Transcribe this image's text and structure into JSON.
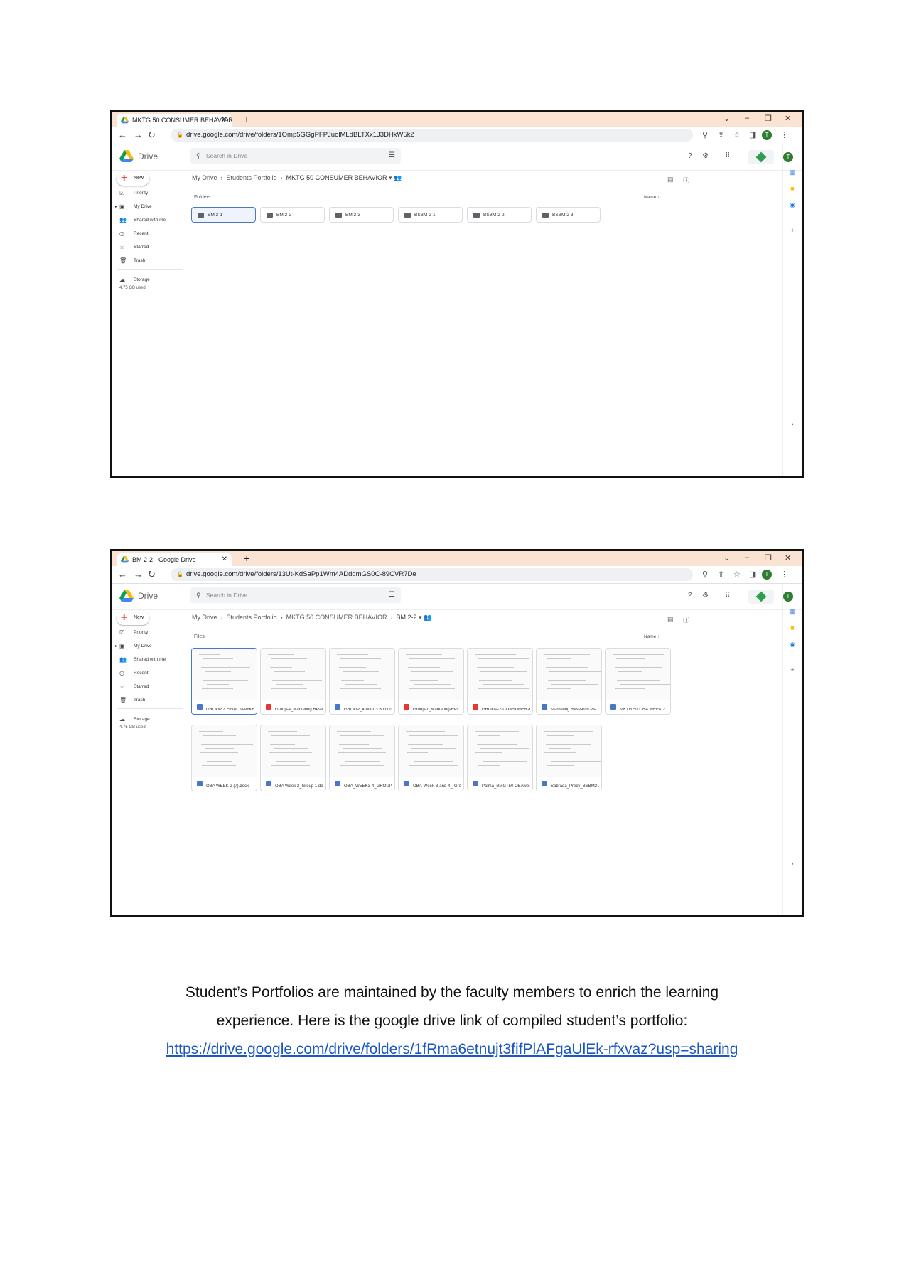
{
  "screenshot1": {
    "tab_title": "MKTG 50 CONSUMER BEHAVIOR",
    "url": "drive.google.com/drive/folders/1Omp5GGgPFPJuolMLdBLTXx1J3DHkW5kZ",
    "app_name": "Drive",
    "search_placeholder": "Search in Drive",
    "avatar_letter": "T",
    "new_label": "New",
    "nav": [
      "Priority",
      "My Drive",
      "Shared with me",
      "Recent",
      "Starred",
      "Trash",
      "Storage"
    ],
    "storage_used": "4.75 GB used",
    "breadcrumb": [
      "My Drive",
      "Students Portfolio",
      "MKTG 50 CONSUMER BEHAVIOR"
    ],
    "section_label": "Folders",
    "sort_label": "Name",
    "folders": [
      "BM 2-1",
      "BM 2-2",
      "BM 2-3",
      "BSBM 2-1",
      "BSBM 2-2",
      "BSBM 2-3"
    ]
  },
  "screenshot2": {
    "tab_title": "BM 2-2 - Google Drive",
    "url": "drive.google.com/drive/folders/13Ut-KdSaPp1Wm4ADddmGS0C-89CVR7De",
    "app_name": "Drive",
    "search_placeholder": "Search in Drive",
    "avatar_letter": "T",
    "new_label": "New",
    "nav": [
      "Priority",
      "My Drive",
      "Shared with me",
      "Recent",
      "Starred",
      "Trash",
      "Storage"
    ],
    "storage_used": "4.75 GB used",
    "breadcrumb": [
      "My Drive",
      "Students Portfolio",
      "MKTG 50 CONSUMER BEHAVIOR",
      "BM 2-2"
    ],
    "section_label": "Files",
    "sort_label": "Name",
    "files": [
      {
        "name": "GROUP 2 FINAL MARKE...",
        "type": "word"
      },
      {
        "name": "Group-4_Marketing Rese...",
        "type": "pdf"
      },
      {
        "name": "GROUP_4 MKTG 50.docx",
        "type": "word"
      },
      {
        "name": "Group-1_Marketing-Res...",
        "type": "pdf"
      },
      {
        "name": "GROUP-2-CONSUMER-B...",
        "type": "pdf"
      },
      {
        "name": "Marketing Research Pla...",
        "type": "word"
      },
      {
        "name": "MKTG 50 OBA WEEK 2 ...",
        "type": "word"
      },
      {
        "name": "OBA WEEK 2 (7).docx",
        "type": "word"
      },
      {
        "name": "OBA Week 2_Group 1.do...",
        "type": "word"
      },
      {
        "name": "OBA_WEEK3-4_GROUP-...",
        "type": "word"
      },
      {
        "name": "OBA-Week-3-and-4_-Gro...",
        "type": "word"
      },
      {
        "name": "Palma_BMGT50 OBAwe...",
        "type": "word"
      },
      {
        "name": "Sabrada_Precy_BSBM2-...",
        "type": "word"
      }
    ]
  },
  "caption": {
    "line1": "Student’s Portfolios are maintained by the faculty members to enrich the learning",
    "line2": "experience. Here is the google drive link of compiled student’s portfolio:",
    "link": "https://drive.google.com/drive/folders/1fRma6etnujt3fifPlAFgaUlEk-rfxvaz?usp=sharing"
  },
  "colors": {
    "tabbar": "#fbe3d3",
    "selection": "#4a78c9",
    "word": "#4a78c9",
    "pdf": "#e53935",
    "link": "#1a56c4"
  }
}
